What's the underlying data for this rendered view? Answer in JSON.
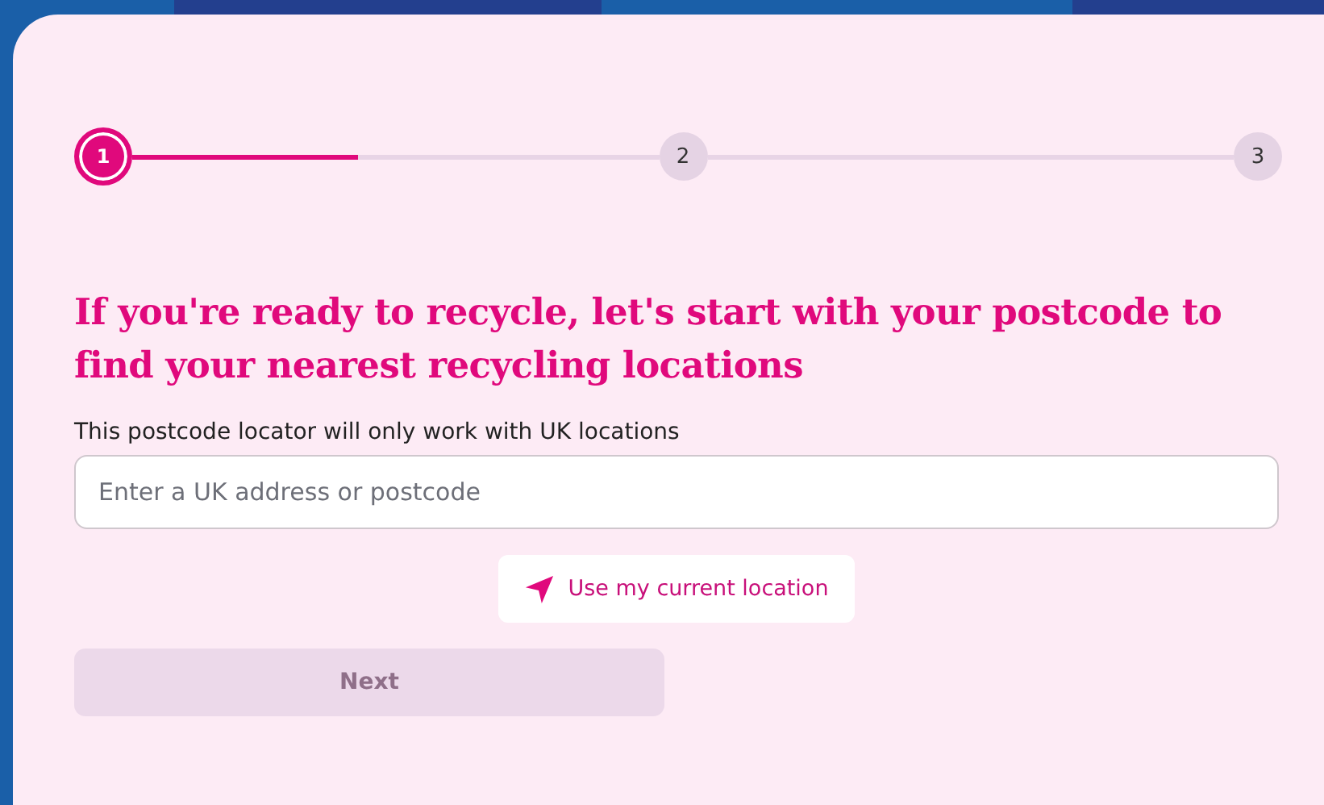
{
  "steps": [
    {
      "label": "1",
      "selected": true
    },
    {
      "label": "2",
      "selected": false
    },
    {
      "label": "3",
      "selected": false
    }
  ],
  "progress": {
    "level": 0.43
  },
  "heading": "If you're ready to recycle, let's start with your postcode to find your nearest recycling locations",
  "hint": "This postcode locator will only work with UK locations",
  "address_field": {
    "placeholder": "Enter a UK address or postcode"
  },
  "location_button": {
    "label": "Use my current location"
  },
  "next_button": {
    "label": "Next",
    "disabled": true
  }
}
